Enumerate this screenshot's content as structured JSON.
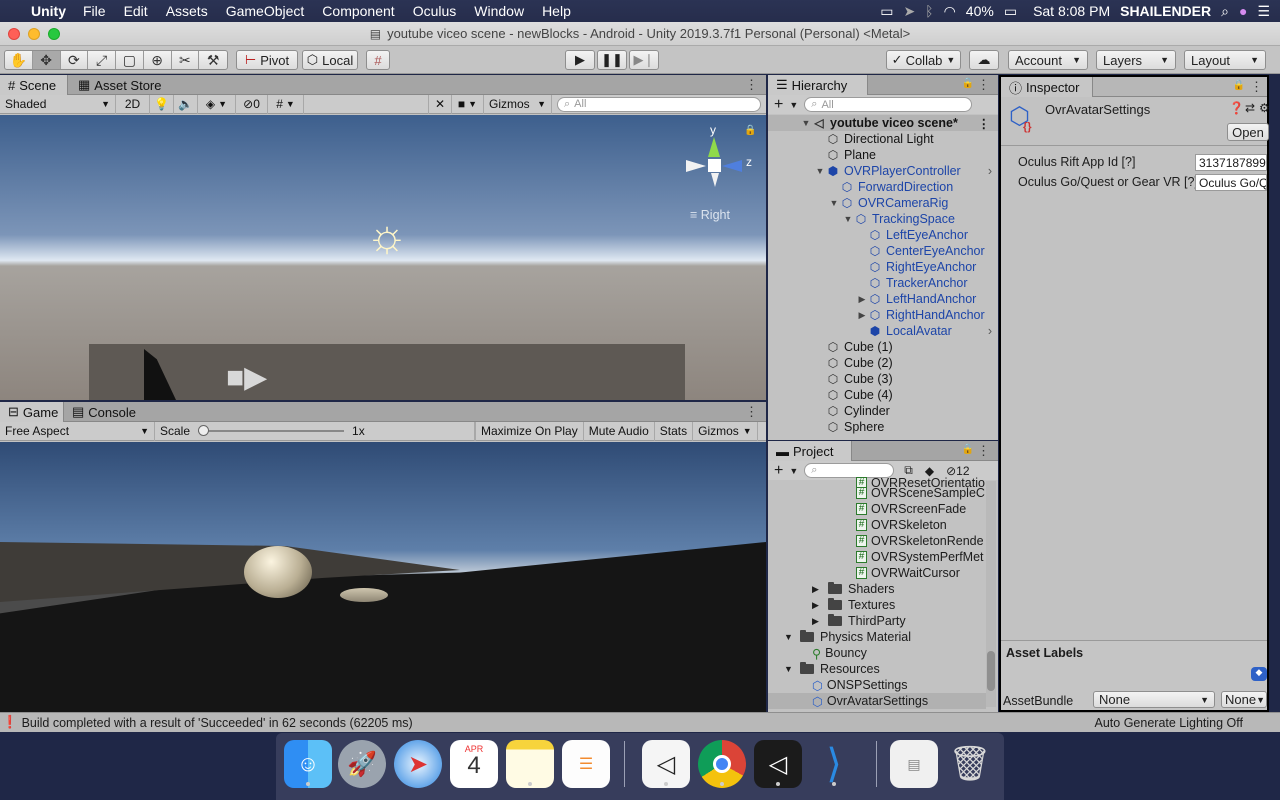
{
  "menubar": {
    "app": "Unity",
    "items": [
      "File",
      "Edit",
      "Assets",
      "GameObject",
      "Component",
      "Oculus",
      "Window",
      "Help"
    ],
    "battery": "40%",
    "datetime": "Sat 8:08 PM",
    "user": "SHAILENDER"
  },
  "window": {
    "title": "youtube viceo scene - newBlocks - Android - Unity 2019.3.7f1 Personal (Personal) <Metal>"
  },
  "toolbar": {
    "pivot": "Pivot",
    "local": "Local",
    "collab": "Collab",
    "account": "Account",
    "layers": "Layers",
    "layout": "Layout"
  },
  "scene": {
    "tab": "Scene",
    "tab2": "Asset Store",
    "shading": "Shaded",
    "mode2d": "2D",
    "hidden_count": "0",
    "gizmos": "Gizmos",
    "search_placeholder": "All",
    "axis_y": "y",
    "axis_z": "z",
    "view_label": "Right"
  },
  "game": {
    "tab": "Game",
    "tab2": "Console",
    "aspect": "Free Aspect",
    "scale_label": "Scale",
    "scale_value": "1x",
    "maximize": "Maximize On Play",
    "mute": "Mute Audio",
    "stats": "Stats",
    "gizmos": "Gizmos"
  },
  "hierarchy": {
    "tab": "Hierarchy",
    "search_placeholder": "All",
    "scene_name": "youtube viceo scene*",
    "items": [
      "Directional Light",
      "Plane",
      "OVRPlayerController",
      "ForwardDirection",
      "OVRCameraRig",
      "TrackingSpace",
      "LeftEyeAnchor",
      "CenterEyeAnchor",
      "RightEyeAnchor",
      "TrackerAnchor",
      "LeftHandAnchor",
      "RightHandAnchor",
      "LocalAvatar",
      "Cube (1)",
      "Cube (2)",
      "Cube (3)",
      "Cube (4)",
      "Cylinder",
      "Sphere"
    ]
  },
  "project": {
    "tab": "Project",
    "badge_count": "12",
    "items": [
      "OVRResetOrientatio",
      "OVRSceneSampleC",
      "OVRScreenFade",
      "OVRSkeleton",
      "OVRSkeletonRende",
      "OVRSystemPerfMet",
      "OVRWaitCursor",
      "Shaders",
      "Textures",
      "ThirdParty",
      "Physics Material",
      "Bouncy",
      "Resources",
      "ONSPSettings",
      "OvrAvatarSettings"
    ]
  },
  "inspector": {
    "tab": "Inspector",
    "asset_name": "OvrAvatarSettings",
    "open": "Open",
    "field1_label": "Oculus Rift App Id [?]",
    "field1_value": "3137187899",
    "field2_label": "Oculus Go/Quest or Gear VR [?]",
    "field2_value": "Oculus Go/Q",
    "asset_labels": "Asset Labels",
    "assetbundle_label": "AssetBundle",
    "assetbundle_value": "None",
    "variant_value": "None"
  },
  "status": {
    "message": "Build completed with a result of 'Succeeded' in 62 seconds (62205 ms)",
    "right": "Auto Generate Lighting Off"
  },
  "dock": {
    "calendar_month": "APR",
    "calendar_day": "4"
  }
}
